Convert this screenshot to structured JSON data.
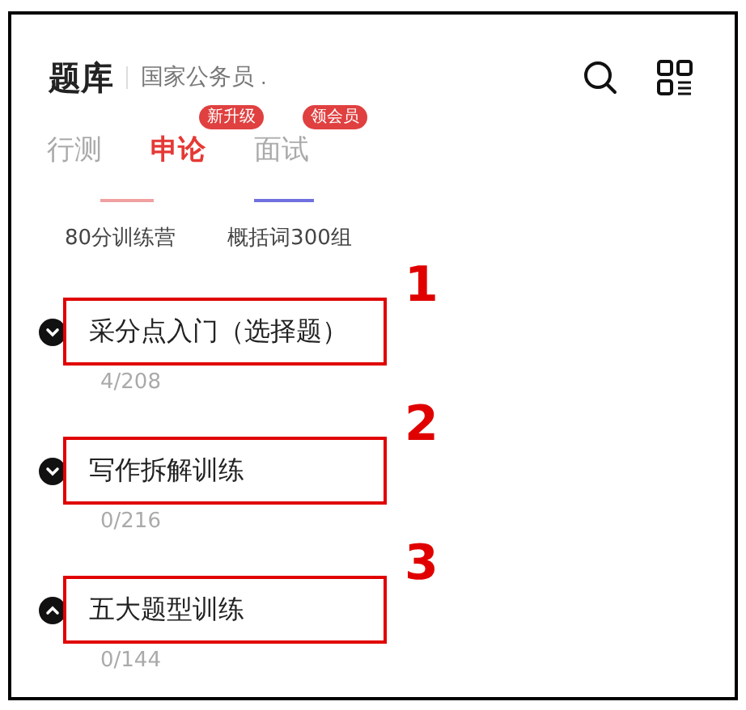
{
  "header": {
    "title": "题库",
    "exam": "国家公务员",
    "exam_suffix": "."
  },
  "tabs": [
    {
      "label": "行测",
      "selected": false
    },
    {
      "label": "申论",
      "selected": true,
      "badge": "新升级"
    },
    {
      "label": "面试",
      "selected": false,
      "badge": "领会员"
    }
  ],
  "sub_items": [
    "80分训练营",
    "概括词300组"
  ],
  "sections": [
    {
      "title": "采分点入门（选择题）",
      "count": "4/208",
      "expanded": false,
      "annotation": "1"
    },
    {
      "title": "写作拆解训练",
      "count": "0/216",
      "expanded": false,
      "annotation": "2"
    },
    {
      "title": "五大题型训练",
      "count": "0/144",
      "expanded": true,
      "annotation": "3"
    }
  ]
}
